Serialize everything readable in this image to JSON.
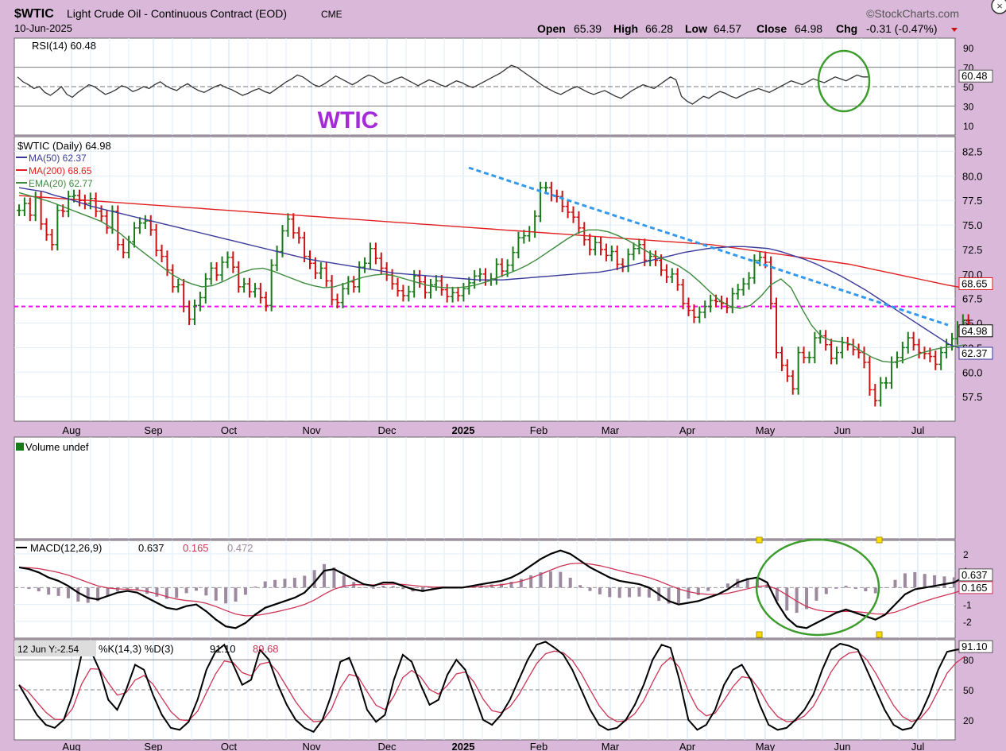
{
  "header": {
    "symbol": "$WTIC",
    "name": "Light Crude Oil - Continuous Contract (EOD)",
    "exchange": "CME",
    "date": "10-Jun-2025",
    "brand": "©StockCharts.com",
    "open_label": "Open",
    "open": "65.39",
    "high_label": "High",
    "high": "66.28",
    "low_label": "Low",
    "low": "64.57",
    "close_label": "Close",
    "close": "64.98",
    "chg_label": "Chg",
    "chg": "-0.31 (-0.47%)"
  },
  "watermark": "WTIC",
  "x_months": [
    "Aug",
    "Sep",
    "Oct",
    "Nov",
    "Dec",
    "2025",
    "Feb",
    "Mar",
    "Apr",
    "May",
    "Jun",
    "Jul"
  ],
  "rsi": {
    "legend": "RSI(14) 60.48",
    "ticks": [
      "90",
      "70",
      "50",
      "30",
      "10"
    ],
    "last_label": "60.48",
    "ylim": [
      0,
      100
    ],
    "values": [
      60,
      55,
      52,
      48,
      50,
      44,
      41,
      45,
      50,
      42,
      39,
      44,
      48,
      52,
      50,
      46,
      42,
      44,
      47,
      51,
      49,
      45,
      47,
      50,
      48,
      52,
      55,
      51,
      48,
      46,
      50,
      53,
      49,
      46,
      44,
      47,
      50,
      52,
      49,
      47,
      44,
      41,
      43,
      46,
      48,
      45,
      43,
      47,
      51,
      55,
      58,
      62,
      60,
      56,
      52,
      50,
      53,
      57,
      61,
      58,
      55,
      52,
      55,
      59,
      62,
      60,
      56,
      53,
      55,
      58,
      60,
      57,
      54,
      51,
      54,
      57,
      55,
      52,
      50,
      53,
      56,
      54,
      51,
      49,
      52,
      55,
      58,
      61,
      64,
      68,
      72,
      70,
      66,
      62,
      58,
      54,
      50,
      47,
      44,
      42,
      45,
      48,
      50,
      47,
      44,
      42,
      44,
      46,
      43,
      40,
      38,
      42,
      46,
      49,
      52,
      50,
      48,
      52,
      56,
      60,
      57,
      40,
      35,
      32,
      36,
      40,
      38,
      42,
      45,
      43,
      40,
      38,
      41,
      44,
      46,
      48,
      46,
      44,
      47,
      50,
      53,
      56,
      54,
      52,
      55,
      58,
      56,
      54,
      57,
      60,
      58,
      56,
      59,
      62,
      60,
      60
    ],
    "ref_lines": [
      70,
      50,
      30
    ]
  },
  "price": {
    "legend_title": "$WTIC (Daily) 64.98",
    "ma50_label": "MA(50) 62.37",
    "ma200_label": "MA(200) 68.65",
    "ema20_label": "EMA(20) 62.77",
    "ticks": [
      "82.5",
      "80.0",
      "77.5",
      "75.0",
      "72.5",
      "70.0",
      "67.5",
      "65.0",
      "62.5",
      "60.0",
      "57.5"
    ],
    "ylim": [
      55,
      84
    ],
    "hline": 66.7,
    "close_label": "64.98",
    "ma200_tag": "68.65",
    "ma50_tag": "62.37",
    "trendline": [
      [
        80.8,
        64.5
      ],
      [
        157,
        63.2
      ]
    ],
    "colors": {
      "up": "#1a7a1a",
      "down": "#cc1111",
      "ma50": "#3a3a9a",
      "ma200": "#e02020",
      "ema20": "#3d8b3d",
      "hline": "#ff00ff",
      "trend": "#3399ee"
    },
    "closes": [
      76.5,
      77.2,
      76.0,
      77.8,
      75.1,
      74.0,
      73.0,
      76.5,
      76.4,
      77.9,
      78.0,
      77.5,
      77.2,
      77.7,
      76.4,
      75.9,
      74.7,
      76.4,
      73.0,
      72.2,
      73.3,
      74.7,
      75.2,
      75.4,
      74.5,
      72.4,
      71.8,
      70.4,
      68.7,
      68.9,
      66.7,
      65.4,
      66.8,
      67.6,
      69.5,
      70.6,
      69.9,
      71.2,
      71.7,
      70.7,
      68.7,
      69.0,
      68.2,
      68.5,
      67.6,
      66.8,
      70.9,
      72.3,
      74.4,
      75.6,
      74.2,
      73.7,
      71.8,
      71.1,
      70.1,
      70.6,
      69.3,
      67.4,
      67.1,
      68.5,
      69.2,
      68.7,
      70.7,
      71.1,
      72.6,
      71.6,
      70.6,
      69.9,
      69.0,
      68.3,
      67.8,
      68.2,
      69.8,
      69.2,
      68.1,
      68.9,
      69.3,
      68.4,
      67.7,
      68.1,
      67.8,
      68.5,
      69.1,
      69.8,
      70.0,
      69.4,
      69.5,
      71.0,
      70.3,
      70.9,
      72.2,
      73.7,
      73.9,
      74.3,
      75.9,
      78.8,
      78.8,
      78.0,
      77.9,
      76.9,
      76.3,
      75.8,
      74.7,
      73.5,
      72.5,
      73.2,
      72.5,
      71.9,
      72.3,
      71.0,
      70.8,
      72.0,
      72.6,
      73.0,
      71.4,
      71.8,
      71.4,
      70.4,
      69.7,
      70.0,
      68.9,
      67.0,
      66.3,
      65.6,
      66.1,
      66.7,
      67.3,
      67.2,
      67.0,
      66.6,
      68.0,
      68.4,
      69.0,
      69.6,
      71.4,
      71.7,
      71.2,
      67.0,
      61.99,
      60.7,
      59.6,
      58.3,
      62.0,
      61.5,
      61.5,
      63.5,
      63.7,
      62.8,
      61.4,
      62.0,
      63.0,
      62.8,
      62.3,
      62.0,
      61.0,
      58.2,
      57.1,
      58.9,
      58.9,
      61.0,
      61.5,
      62.5,
      63.5,
      62.8,
      62.0,
      61.9,
      61.6,
      60.8,
      62.0,
      62.8,
      63.4,
      64.6,
      65.3,
      64.98
    ],
    "ma50": [
      78.8,
      78.6,
      78.4,
      78.0,
      77.7,
      77.3,
      76.9,
      76.6,
      76.3,
      76.0,
      75.7,
      75.4,
      75.1,
      74.8,
      74.5,
      74.2,
      73.9,
      73.6,
      73.3,
      73.0,
      72.7,
      72.4,
      72.1,
      71.8,
      71.5,
      71.3,
      71.1,
      70.9,
      70.7,
      70.5,
      70.3,
      70.1,
      70.0,
      69.9,
      69.8,
      69.7,
      69.6,
      69.5,
      69.4,
      69.4,
      69.4,
      69.5,
      69.6,
      69.7,
      69.8,
      69.9,
      70.0,
      70.1,
      70.2,
      70.4,
      70.7,
      71.0,
      71.3,
      71.6,
      71.9,
      72.2,
      72.4,
      72.6,
      72.7,
      72.8,
      72.8,
      72.7,
      72.6,
      72.3,
      71.9,
      71.5,
      71.0,
      70.4,
      69.8,
      69.1,
      68.4,
      67.6,
      66.8,
      66.0,
      65.2,
      64.4,
      63.6,
      62.8,
      62.37
    ],
    "ma50_start": 10,
    "ma200": [
      78.0,
      77.9,
      77.8,
      77.7,
      77.6,
      77.5,
      77.4,
      77.3,
      77.2,
      77.1,
      77.0,
      76.9,
      76.8,
      76.7,
      76.6,
      76.5,
      76.4,
      76.3,
      76.2,
      76.1,
      76.0,
      75.9,
      75.8,
      75.7,
      75.6,
      75.5,
      75.4,
      75.3,
      75.2,
      75.1,
      75.0,
      74.9,
      74.8,
      74.7,
      74.6,
      74.5,
      74.4,
      74.3,
      74.2,
      74.1,
      74.0,
      73.9,
      73.8,
      73.7,
      73.6,
      73.5,
      73.4,
      73.3,
      73.2,
      73.1,
      73.0,
      72.8,
      72.6,
      72.4,
      72.2,
      72.0,
      71.8,
      71.6,
      71.4,
      71.2,
      71.0,
      70.7,
      70.4,
      70.1,
      69.8,
      69.5,
      69.2,
      68.9,
      68.65
    ],
    "ma200_start": 13,
    "ema20": [
      78.3,
      78.0,
      77.7,
      77.4,
      77.0,
      76.6,
      76.2,
      75.8,
      75.4,
      74.8,
      74.1,
      73.2,
      72.4,
      71.6,
      70.8,
      70.0,
      69.4,
      69.0,
      68.7,
      68.8,
      69.2,
      69.7,
      70.2,
      70.5,
      70.6,
      70.3,
      69.9,
      69.5,
      69.1,
      68.8,
      68.6,
      68.7,
      69.0,
      69.4,
      69.7,
      69.9,
      70.0,
      69.8,
      69.5,
      69.2,
      68.9,
      68.7,
      68.6,
      68.6,
      68.7,
      68.9,
      69.2,
      69.6,
      70.0,
      70.4,
      70.9,
      71.5,
      72.2,
      72.9,
      73.6,
      74.2,
      74.5,
      74.5,
      74.3,
      73.9,
      73.4,
      72.8,
      72.2,
      71.7,
      71.3,
      70.8,
      70.1,
      69.2,
      68.2,
      67.3,
      66.7,
      66.5,
      66.8,
      67.7,
      68.9,
      69.5,
      68.6,
      66.6,
      64.8,
      63.6,
      63.2,
      63.1,
      62.8,
      62.1,
      61.5,
      61.1,
      61.0,
      61.2,
      61.6,
      62.0,
      62.3,
      62.5,
      62.6,
      62.77
    ],
    "ema20_start": 0
  },
  "volume": {
    "legend": "Volume undef"
  },
  "macd": {
    "legend_prefix": "MACD(12,26,9)",
    "v1": "0.637",
    "v2": "0.165",
    "v3": "0.472",
    "ticks": [
      "2",
      "1",
      "0",
      "-1",
      "-2"
    ],
    "ylim": [
      -3,
      2.8
    ],
    "tag1": "0.637",
    "tag2": "0.165",
    "macd": [
      1.2,
      1.1,
      0.9,
      0.6,
      0.4,
      0.1,
      -0.3,
      -0.6,
      -0.7,
      -0.5,
      -0.3,
      -0.2,
      -0.3,
      -0.6,
      -0.9,
      -1.2,
      -1.3,
      -1.1,
      -1.0,
      -1.4,
      -1.9,
      -2.3,
      -2.4,
      -2.1,
      -1.6,
      -1.2,
      -1.0,
      -0.8,
      -0.6,
      -0.3,
      0.3,
      1.0,
      1.1,
      0.8,
      0.5,
      0.2,
      0.1,
      0.3,
      0.3,
      0.1,
      -0.1,
      -0.2,
      -0.1,
      0.0,
      0.0,
      0.0,
      0.1,
      0.2,
      0.3,
      0.4,
      0.6,
      0.9,
      1.3,
      1.7,
      2.0,
      2.2,
      2.0,
      1.6,
      1.2,
      0.9,
      0.6,
      0.4,
      0.3,
      0.2,
      0.0,
      -0.4,
      -0.8,
      -1.0,
      -0.9,
      -0.8,
      -0.6,
      -0.4,
      -0.1,
      0.3,
      0.5,
      0.6,
      0.3,
      -0.9,
      -1.8,
      -2.3,
      -2.4,
      -2.1,
      -1.8,
      -1.5,
      -1.3,
      -1.5,
      -1.7,
      -1.9,
      -1.6,
      -1.0,
      -0.4,
      -0.1,
      0.0,
      0.1,
      0.2,
      0.3,
      0.637
    ]
  },
  "stoch": {
    "cursor_label": "12 Jun Y:-2.54",
    "legend_prefix": "%K(14,3) %D(3)",
    "k": "91.10",
    "d": "89.68",
    "ticks": [
      "80",
      "50",
      "20"
    ],
    "ylim": [
      0,
      100
    ],
    "tag": "91.10",
    "values": [
      55,
      40,
      25,
      15,
      12,
      20,
      45,
      85,
      90,
      70,
      40,
      30,
      50,
      75,
      70,
      45,
      25,
      12,
      10,
      18,
      40,
      70,
      88,
      95,
      75,
      55,
      60,
      90,
      80,
      55,
      35,
      20,
      12,
      8,
      20,
      45,
      78,
      82,
      60,
      30,
      18,
      25,
      60,
      85,
      78,
      55,
      35,
      40,
      65,
      80,
      70,
      45,
      20,
      15,
      25,
      40,
      60,
      80,
      95,
      98,
      92,
      85,
      70,
      50,
      30,
      15,
      10,
      12,
      20,
      35,
      55,
      80,
      95,
      92,
      60,
      20,
      10,
      15,
      30,
      55,
      70,
      75,
      60,
      35,
      15,
      10,
      12,
      20,
      30,
      45,
      70,
      90,
      96,
      94,
      90,
      70,
      50,
      30,
      15,
      10,
      12,
      25,
      45,
      70,
      88,
      90,
      91.1
    ]
  }
}
